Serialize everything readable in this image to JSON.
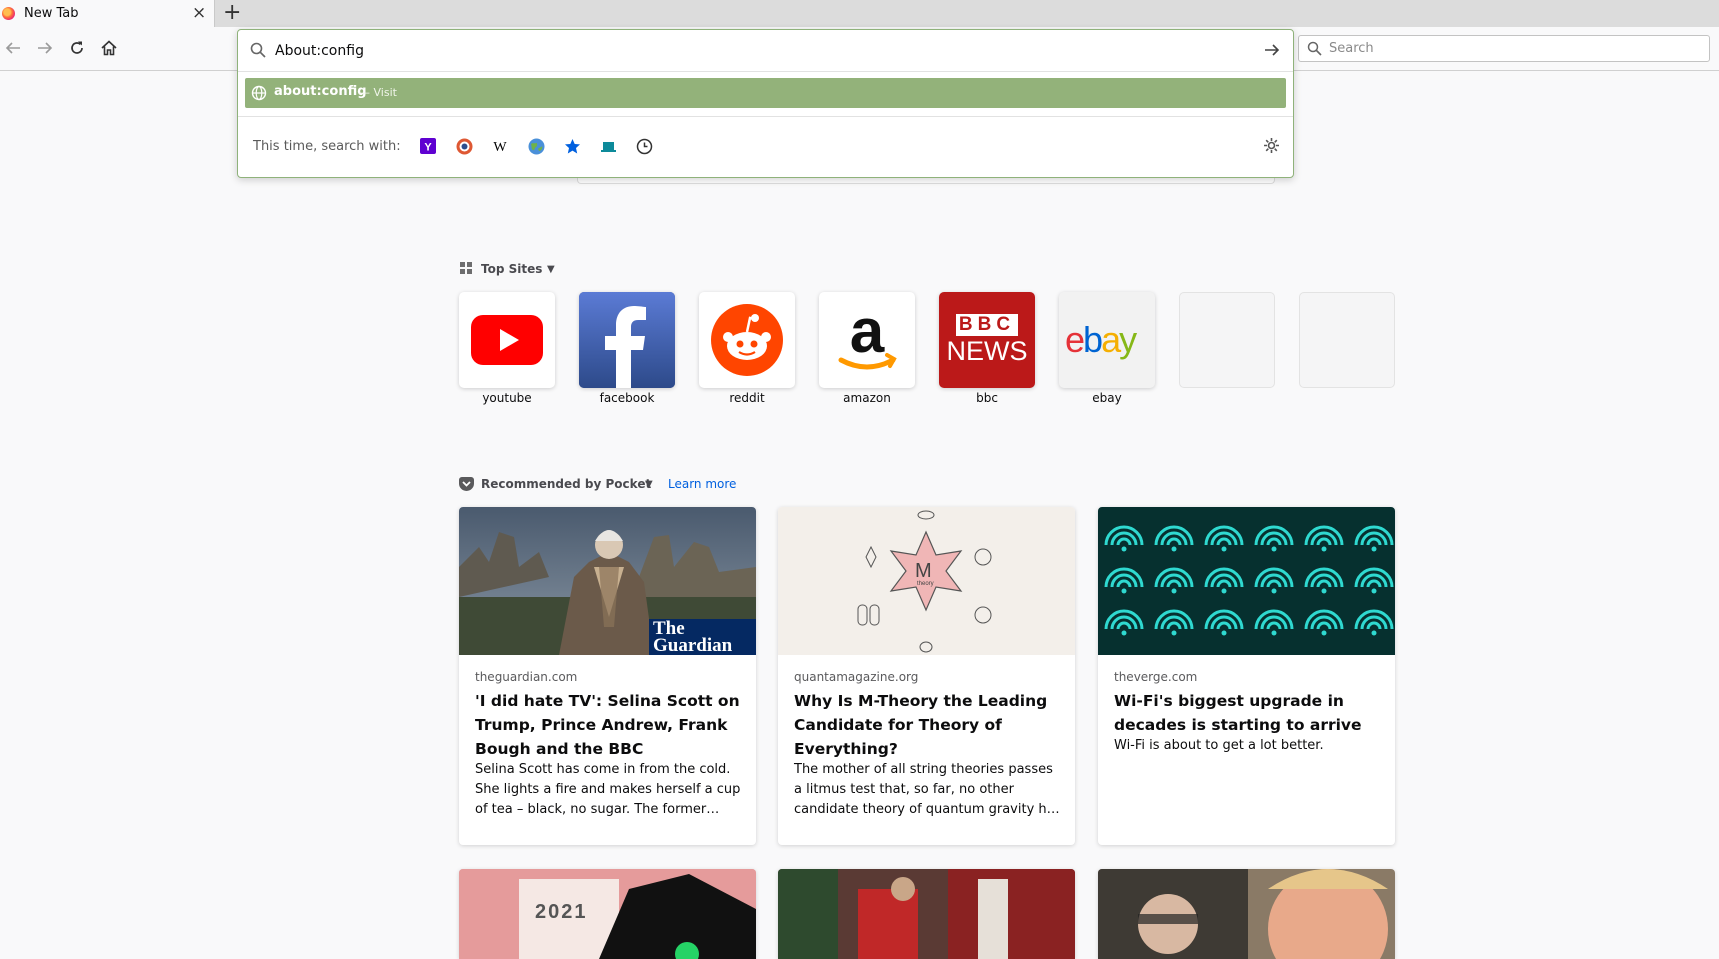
{
  "tab": {
    "title": "New Tab",
    "close": "×"
  },
  "new_tab_symbol": "+",
  "urlbar": {
    "value": "About:config",
    "result": {
      "title": "about:config",
      "action": "— Visit"
    },
    "oneoff_label": "This time, search with:",
    "engines": [
      {
        "name": "yahoo",
        "glyph": "Y!"
      },
      {
        "name": "duckduckgo",
        "glyph": "D"
      },
      {
        "name": "wikipedia",
        "glyph": "W"
      },
      {
        "name": "earth",
        "glyph": "◍"
      },
      {
        "name": "bookmarks",
        "glyph": "★"
      },
      {
        "name": "tabs",
        "glyph": "▬"
      },
      {
        "name": "history",
        "glyph": "◷"
      }
    ]
  },
  "search": {
    "placeholder": "Search"
  },
  "top_sites": {
    "title": "Top Sites",
    "sites": [
      {
        "label": "youtube",
        "icon": "youtube-icon"
      },
      {
        "label": "facebook",
        "icon": "facebook-icon"
      },
      {
        "label": "reddit",
        "icon": "reddit-icon"
      },
      {
        "label": "amazon",
        "icon": "amazon-icon"
      },
      {
        "label": "bbc",
        "icon": "bbc-news-icon",
        "logo_line1": "BBC",
        "logo_line2": "NEWS"
      },
      {
        "label": "ebay",
        "icon": "ebay-icon"
      }
    ]
  },
  "pocket": {
    "title": "Recommended by Pocket",
    "learn_more": "Learn more",
    "cards": [
      {
        "domain": "theguardian.com",
        "headline": "'I did hate TV': Selina Scott on Trump, Prince Andrew, Frank Bough and the BBC",
        "excerpt": "Selina Scott has come in from the cold. She lights a fire and makes herself a cup of tea – black, no sugar. The former…",
        "image_text": "The Guardian"
      },
      {
        "domain": "quantamagazine.org",
        "headline": "Why Is M-Theory the Leading Candidate for Theory of Everything?",
        "excerpt": "The mother of all string theories passes a litmus test that, so far, no other candidate theory of quantum gravity h…",
        "image_text": "M",
        "image_sub": "theory"
      },
      {
        "domain": "theverge.com",
        "headline": "Wi-Fi's biggest upgrade in decades is starting to arrive",
        "excerpt": "Wi-Fi is about to get a lot better."
      }
    ],
    "next_row": [
      {
        "image_text": "2021"
      },
      {},
      {}
    ]
  },
  "colors": {
    "accent": "#93b27a",
    "link": "#0060df",
    "background": "#f9f9fa"
  }
}
